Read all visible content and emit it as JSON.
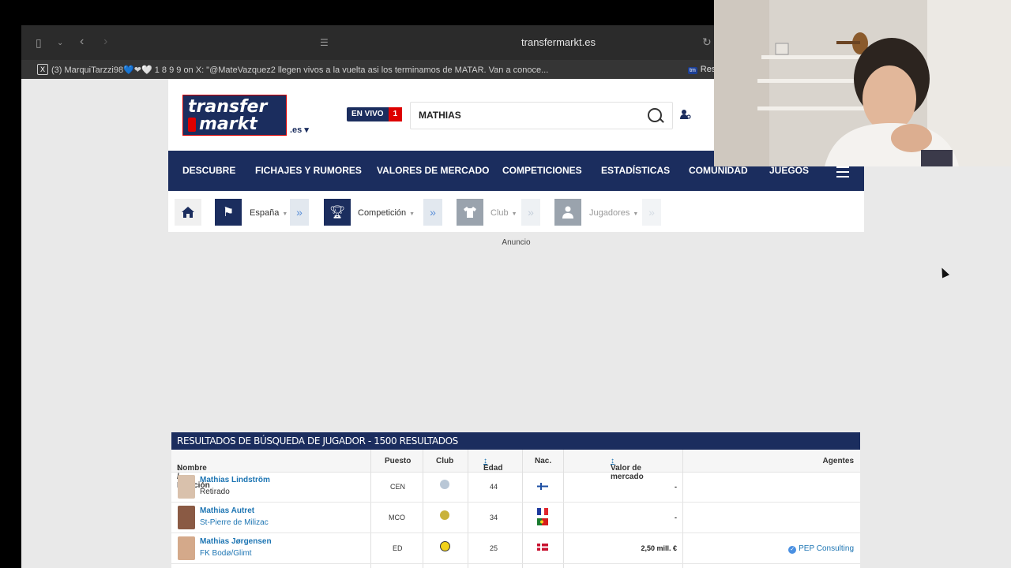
{
  "browser": {
    "url": "transfermarkt.es",
    "tab_title": "(3) MarquiTarzzi98💙❤🤍 1 8 9 9 on X: \"@MateVazquez2 llegen vivos a la vuelta asi los terminamos de MATAR. Van a conoce...",
    "tab_right_label": "Res",
    "tab_right_badge": "tm"
  },
  "site": {
    "logo_line1": "transfer",
    "logo_line2": "markt",
    "tld": ".es",
    "live_label": "EN VIVO",
    "live_count": "1",
    "search_value": "MATHIAS"
  },
  "nav": {
    "items": [
      "DESCUBRE",
      "FICHAJES Y RUMORES",
      "VALORES DE MERCADO",
      "COMPETICIONES",
      "ESTADÍSTICAS",
      "COMUNIDAD",
      "JUEGOS"
    ]
  },
  "breadcrumb": {
    "items": [
      "España",
      "Competición",
      "Club",
      "Jugadores"
    ]
  },
  "ad_label": "Anuncio",
  "results": {
    "title": "RESULTADOS DE BÚSQUEDA DE JUGADOR - 1500 RESULTADOS",
    "columns": {
      "name": "Nombre / Posición",
      "position": "Puesto",
      "club": "Club",
      "age": "Edad",
      "nationality": "Nac.",
      "market_value": "Valor de mercado",
      "agents": "Agentes"
    },
    "rows": [
      {
        "name": "Mathias Lindström",
        "sub": "Retirado",
        "position": "CEN",
        "age": "44",
        "market_value": "-",
        "agent": ""
      },
      {
        "name": "Mathias Autret",
        "sub": "St-Pierre de Milizac",
        "position": "MCO",
        "age": "34",
        "market_value": "-",
        "agent": ""
      },
      {
        "name": "Mathias Jørgensen",
        "sub": "FK Bodø/Glimt",
        "position": "ED",
        "age": "25",
        "market_value": "2,50 mill. €",
        "agent": "PEP Consulting"
      }
    ]
  },
  "colors": {
    "navy": "#1b2d5e",
    "link": "#1d75b3",
    "live_red": "#d00000"
  }
}
